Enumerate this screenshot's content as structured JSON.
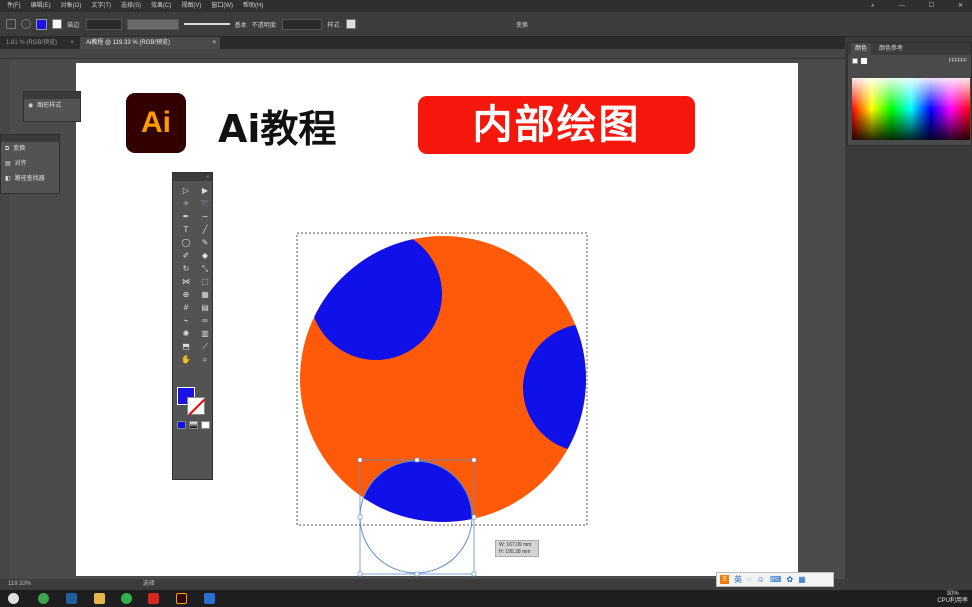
{
  "menubar": {
    "items": [
      "件(F)",
      "编辑(E)",
      "对象(O)",
      "文字(T)",
      "选择(S)",
      "效果(C)",
      "视图(V)",
      "窗口(W)",
      "帮助(H)"
    ]
  },
  "controlbar": {
    "stroke_label": "描边:",
    "stroke_profile": "基本",
    "opacity_label": "不透明度:",
    "style_label": "样式:",
    "transform_label": "变换"
  },
  "tabs": {
    "inactive": "1.81 % (RGB/预览)",
    "active": "Ai教程 @ 119.33 % (RGB/预览)",
    "close": "×"
  },
  "artboard": {
    "logo_text": "Ai",
    "course_title": "Ai教程",
    "banner_text": "内部绘图"
  },
  "tooltip": {
    "w": "W: 167.09 mm",
    "h": "H: 195.38 mm"
  },
  "left_panels": {
    "appearance": "图形样式",
    "items": [
      "变换",
      "对齐",
      "路径查找器"
    ]
  },
  "color_panel": {
    "tabs": [
      "颜色",
      "颜色参考"
    ],
    "hex": "FFFFFF"
  },
  "status": {
    "zoom": "119.33%",
    "mode": "选择"
  },
  "tray": {
    "cpu": "30%",
    "cpu_label": "CPU利用率"
  },
  "colors": {
    "orange": "#ff5a0a",
    "blue": "#1010e8",
    "banner_red": "#f5170c",
    "logo_bg": "#330000",
    "logo_text": "#ff9a00"
  },
  "icons": [
    "search-icon",
    "minimize-icon",
    "maximize-icon",
    "close-icon",
    "selection-tool-icon",
    "pen-tool-icon",
    "type-tool-icon",
    "ellipse-tool-icon",
    "hand-tool-icon",
    "zoom-tool-icon"
  ]
}
